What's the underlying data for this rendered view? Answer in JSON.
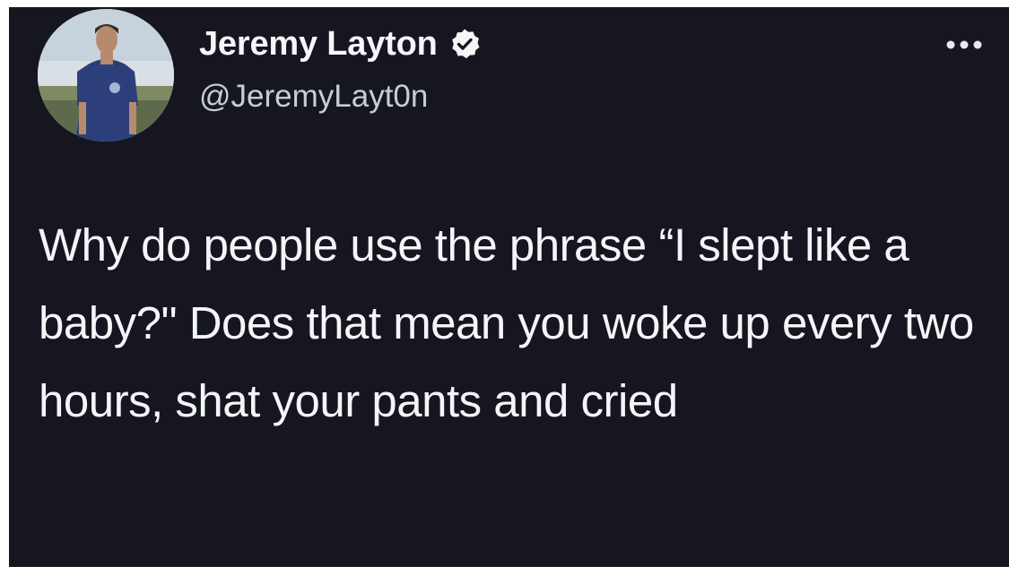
{
  "tweet": {
    "author": {
      "display_name": "Jeremy Layton",
      "handle": "@JeremyLayt0n",
      "verified": true,
      "avatar_icon": "profile-photo-icon"
    },
    "text": "Why do people use the phrase “I slept like a baby?\" Does that mean you woke up every two hours, shat your pants and cried",
    "more_icon": "ellipsis-icon",
    "verified_icon": "verified-check-icon"
  },
  "theme": {
    "background": "#15161f",
    "text_primary": "#f4f5f7",
    "text_secondary": "#c9ccd3"
  }
}
